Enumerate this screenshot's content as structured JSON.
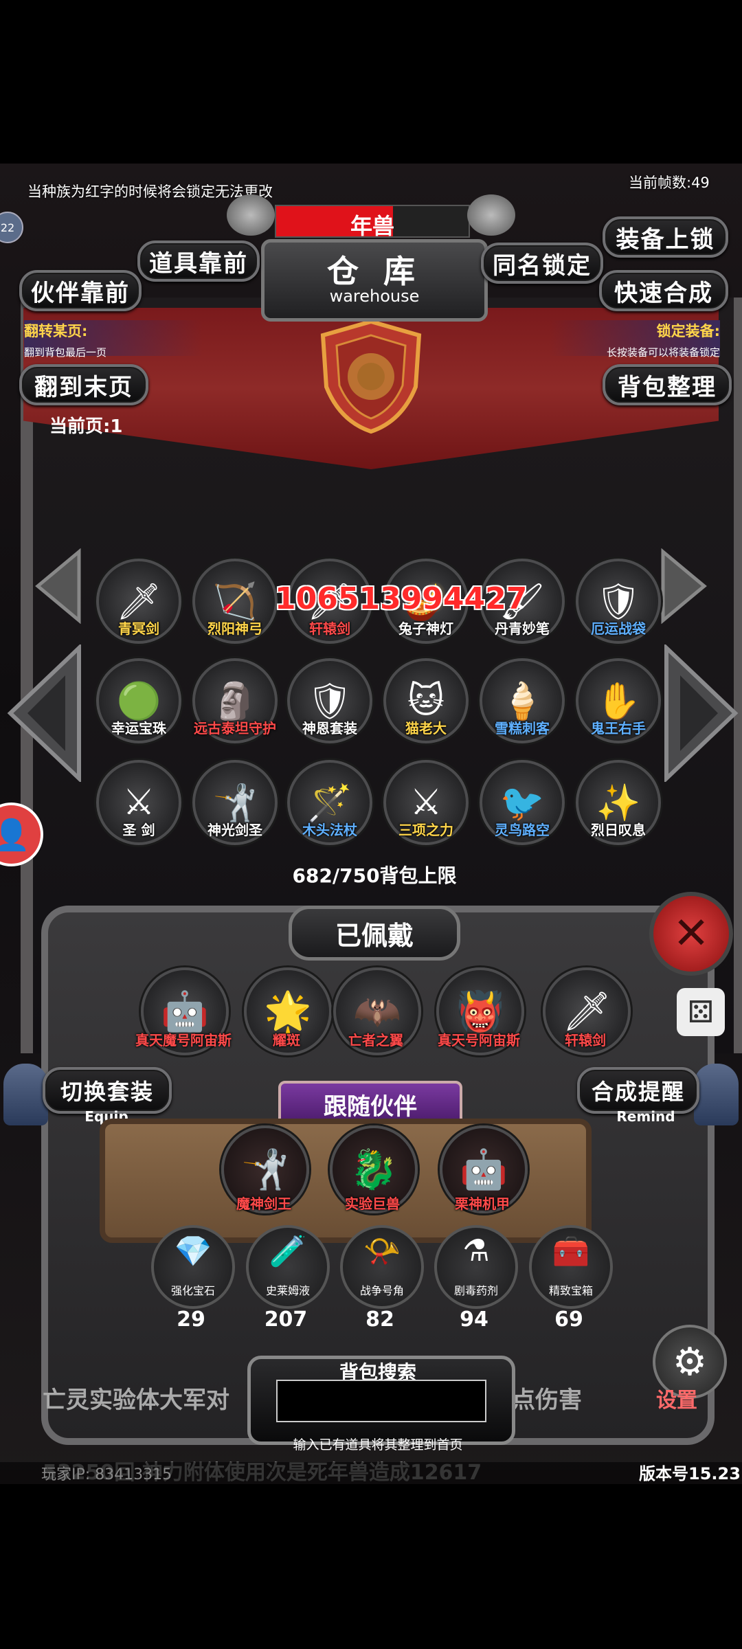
{
  "status": {
    "hint": "当种族为红字的时候将会锁定无法更改",
    "fps": "当前帧数:49",
    "badge": "22"
  },
  "top": {
    "boss_name": "年兽",
    "title": "仓 库",
    "subtitle": "warehouse"
  },
  "buttons": {
    "item_front": "道具靠前",
    "partner_front": "伙伴靠前",
    "same_name_lock": "同名锁定",
    "equip_lock": "装备上锁",
    "quick_merge": "快速合成",
    "last_page": "翻到末页",
    "sort_bag": "背包整理"
  },
  "left_info": {
    "title": "翻转某页:",
    "desc": "翻到背包最后一页"
  },
  "right_info": {
    "title": "锁定装备:",
    "desc": "长按装备可以将装备锁定"
  },
  "current_page": "当前页:1",
  "damage_popup": "10651399442",
  "damage_trail": "7",
  "bag_items": [
    {
      "name": "青冥剑",
      "icon": "sword-icon",
      "glyph": "🗡",
      "color": "#ffd54a"
    },
    {
      "name": "烈阳神弓",
      "icon": "bow-icon",
      "glyph": "🏹",
      "color": "#ffd54a"
    },
    {
      "name": "轩辕剑",
      "icon": "sword-icon",
      "glyph": "🗡",
      "color": "#ff4a4a"
    },
    {
      "name": "兔子神灯",
      "icon": "lamp-icon",
      "glyph": "🪔",
      "color": "#ffffff"
    },
    {
      "name": "丹青妙笔",
      "icon": "brush-icon",
      "glyph": "🖌",
      "color": "#ffffff"
    },
    {
      "name": "厄运战袋",
      "icon": "armor-icon",
      "glyph": "🛡",
      "color": "#5fb0ff"
    },
    {
      "name": "幸运宝珠",
      "icon": "orb-icon",
      "glyph": "🟢",
      "color": "#ffffff"
    },
    {
      "name": "远古泰坦守护",
      "icon": "titan-icon",
      "glyph": "🗿",
      "color": "#ff4a4a"
    },
    {
      "name": "神恩套装",
      "icon": "armor-icon",
      "glyph": "🛡",
      "color": "#ffffff"
    },
    {
      "name": "猫老大",
      "icon": "cat-icon",
      "glyph": "🐱",
      "color": "#ffd54a"
    },
    {
      "name": "雪糕刺客",
      "icon": "dagger-icon",
      "glyph": "🍦",
      "color": "#5fb0ff"
    },
    {
      "name": "鬼王右手",
      "icon": "hand-icon",
      "glyph": "✋",
      "color": "#5fb0ff"
    },
    {
      "name": "圣 剑",
      "icon": "sword-icon",
      "glyph": "⚔",
      "color": "#ffffff"
    },
    {
      "name": "神光剑圣",
      "icon": "knight-icon",
      "glyph": "🤺",
      "color": "#ffffff"
    },
    {
      "name": "木头法杖",
      "icon": "staff-icon",
      "glyph": "🪄",
      "color": "#5fb0ff"
    },
    {
      "name": "三项之力",
      "icon": "trinity-icon",
      "glyph": "⚔",
      "color": "#ffd54a"
    },
    {
      "name": "灵鸟路空",
      "icon": "bird-icon",
      "glyph": "🐦",
      "color": "#5fb0ff"
    },
    {
      "name": "烈日叹息",
      "icon": "scepter-icon",
      "glyph": "✨",
      "color": "#ffffff"
    }
  ],
  "bag_capacity": "682/750背包上限",
  "worn": {
    "title": "已佩戴",
    "items": [
      {
        "name": "真天魔号阿宙斯",
        "icon": "mecha-icon",
        "glyph": "🤖"
      },
      {
        "name": "耀斑",
        "icon": "sun-icon",
        "glyph": "🌟"
      },
      {
        "name": "亡者之翼",
        "icon": "wing-icon",
        "glyph": "🦇"
      },
      {
        "name": "真天号阿宙斯",
        "icon": "mecha-icon",
        "glyph": "👹"
      },
      {
        "name": "轩辕剑",
        "icon": "sword-icon",
        "glyph": "🗡"
      }
    ]
  },
  "switch_outfit": {
    "label": "切换套装",
    "sub": "Equip"
  },
  "merge_reminder": {
    "label": "合成提醒",
    "sub": "Remind"
  },
  "follow": {
    "title": "跟随伙伴",
    "partners": [
      {
        "name": "魔神剑王",
        "icon": "knight-icon",
        "glyph": "🤺"
      },
      {
        "name": "实验巨兽",
        "icon": "beast-icon",
        "glyph": "🐉"
      },
      {
        "name": "栗神机甲",
        "icon": "robot-icon",
        "glyph": "🤖"
      }
    ]
  },
  "materials": [
    {
      "name": "强化宝石",
      "count": "29",
      "icon": "gem-icon",
      "glyph": "💎"
    },
    {
      "name": "史莱姆液",
      "count": "207",
      "icon": "potion-icon",
      "glyph": "🧪"
    },
    {
      "name": "战争号角",
      "count": "82",
      "icon": "horn-icon",
      "glyph": "📯"
    },
    {
      "name": "剧毒药剂",
      "count": "94",
      "icon": "poison-icon",
      "glyph": "⚗"
    },
    {
      "name": "精致宝箱",
      "count": "69",
      "icon": "chest-icon",
      "glyph": "🧰"
    }
  ],
  "search": {
    "title": "背包搜索",
    "hint": "输入已有道具将其整理到首页",
    "value": ""
  },
  "ticker": {
    "line1_left": "亡灵实验体大军对",
    "line1_right": "点伤害",
    "line2": "53250回 神力附体使用次是死年兽造成12617"
  },
  "settings_label": "设置",
  "player_ip": "玩家IP: 83413315",
  "version": "版本号15.23",
  "colors": {
    "banner_red": "#8e2a28",
    "gold": "#ffd54a",
    "hp_red": "#e0121a",
    "frame_grey": "#6f6f72"
  }
}
